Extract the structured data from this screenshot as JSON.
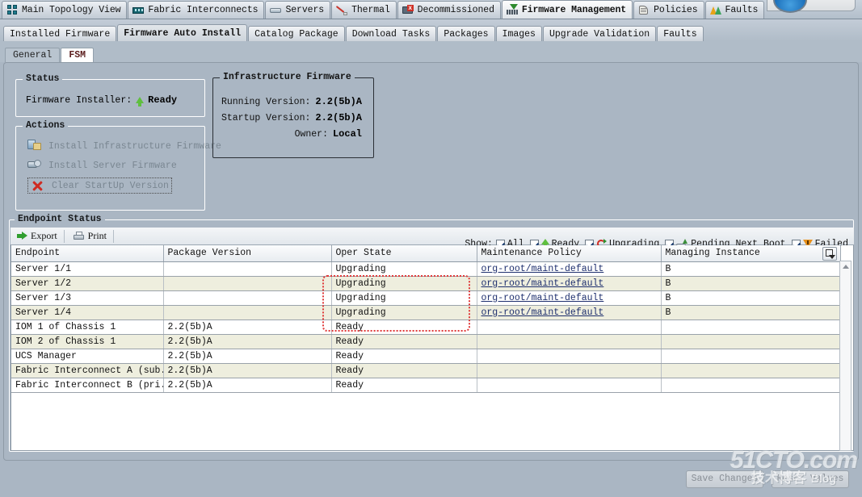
{
  "nav": {
    "tabs": [
      {
        "label": "Main Topology View",
        "icon": "topology-icon",
        "active": false
      },
      {
        "label": "Fabric Interconnects",
        "icon": "fabric-icon",
        "active": false
      },
      {
        "label": "Servers",
        "icon": "servers-icon",
        "active": false
      },
      {
        "label": "Thermal",
        "icon": "thermal-icon",
        "active": false
      },
      {
        "label": "Decommissioned",
        "icon": "decommissioned-icon",
        "active": false
      },
      {
        "label": "Firmware Management",
        "icon": "firmware-icon",
        "active": true
      },
      {
        "label": "Policies",
        "icon": "policies-icon",
        "active": false
      },
      {
        "label": "Faults",
        "icon": "faults-icon",
        "active": false
      }
    ]
  },
  "subnav": {
    "tabs": [
      {
        "label": "Installed Firmware",
        "active": false
      },
      {
        "label": "Firmware Auto Install",
        "active": true
      },
      {
        "label": "Catalog Package",
        "active": false
      },
      {
        "label": "Download Tasks",
        "active": false
      },
      {
        "label": "Packages",
        "active": false
      },
      {
        "label": "Images",
        "active": false
      },
      {
        "label": "Upgrade Validation",
        "active": false
      },
      {
        "label": "Faults",
        "active": false
      }
    ]
  },
  "tertnav": {
    "tabs": [
      {
        "label": "General",
        "active": false
      },
      {
        "label": "FSM",
        "active": true
      }
    ]
  },
  "status": {
    "legend": "Status",
    "installer_label": "Firmware Installer:",
    "installer_value": "Ready",
    "installer_icon": "green-up-arrow-icon"
  },
  "actions": {
    "legend": "Actions",
    "items": [
      {
        "label": "Install Infrastructure Firmware",
        "icon": "install-infrastructure-icon"
      },
      {
        "label": "Install Server Firmware",
        "icon": "install-server-icon"
      },
      {
        "label": "Clear StartUp Version",
        "icon": "clear-red-x-icon"
      }
    ]
  },
  "infrastructure": {
    "legend": "Infrastructure Firmware",
    "rows": [
      {
        "label": "Running Version:",
        "value": "2.2(5b)A"
      },
      {
        "label": "Startup Version:",
        "value": "2.2(5b)A"
      },
      {
        "label": "Owner:",
        "value": "Local"
      }
    ]
  },
  "endpoint": {
    "legend": "Endpoint Status",
    "toolbar": {
      "export_label": "Export",
      "print_label": "Print"
    },
    "filters": {
      "show_label": "Show:",
      "items": [
        {
          "label": "All",
          "checked": true,
          "icon": null
        },
        {
          "label": "Ready",
          "checked": true,
          "icon": "green-up-arrow-icon"
        },
        {
          "label": "Upgrading",
          "checked": true,
          "icon": "refresh-circular-arrows-icon"
        },
        {
          "label": "Pending Next Boot",
          "checked": true,
          "icon": "server-pending-boot-icon"
        },
        {
          "label": "Failed",
          "checked": true,
          "icon": "orange-warning-triangle-icon"
        }
      ]
    },
    "columns": [
      "Endpoint",
      "Package Version",
      "Oper State",
      "Maintenance Policy",
      "Managing Instance"
    ],
    "rows": [
      {
        "endpoint": "Server 1/1",
        "package_version": "",
        "oper_state": "Upgrading",
        "maintenance_policy": "org-root/maint-default",
        "managing_instance": "B"
      },
      {
        "endpoint": "Server 1/2",
        "package_version": "",
        "oper_state": "Upgrading",
        "maintenance_policy": "org-root/maint-default",
        "managing_instance": "B"
      },
      {
        "endpoint": "Server 1/3",
        "package_version": "",
        "oper_state": "Upgrading",
        "maintenance_policy": "org-root/maint-default",
        "managing_instance": "B"
      },
      {
        "endpoint": "Server 1/4",
        "package_version": "",
        "oper_state": "Upgrading",
        "maintenance_policy": "org-root/maint-default",
        "managing_instance": "B"
      },
      {
        "endpoint": "IOM 1 of Chassis 1",
        "package_version": "2.2(5b)A",
        "oper_state": "Ready",
        "maintenance_policy": "",
        "managing_instance": ""
      },
      {
        "endpoint": "IOM 2 of Chassis 1",
        "package_version": "2.2(5b)A",
        "oper_state": "Ready",
        "maintenance_policy": "",
        "managing_instance": ""
      },
      {
        "endpoint": "UCS Manager",
        "package_version": "2.2(5b)A",
        "oper_state": "Ready",
        "maintenance_policy": "",
        "managing_instance": ""
      },
      {
        "endpoint": "Fabric Interconnect A (sub...",
        "package_version": "2.2(5b)A",
        "oper_state": "Ready",
        "maintenance_policy": "",
        "managing_instance": ""
      },
      {
        "endpoint": "Fabric Interconnect B (pri...",
        "package_version": "2.2(5b)A",
        "oper_state": "Ready",
        "maintenance_policy": "",
        "managing_instance": ""
      }
    ]
  },
  "buttons": {
    "save_label": "Save Changes",
    "reset_label": "Reset Values"
  },
  "watermark": {
    "line1": "51CTO.com",
    "line2_cn": "技术博客",
    "line2_en": "Blog"
  },
  "colors": {
    "accent_blue": "#1b6fba",
    "link": "#1e2f6e",
    "annotation_red": "#e03a3a",
    "ready_green": "#5fbf3f",
    "failed_orange": "#e8901a",
    "panel_bg": "#aab6c3",
    "row_alt": "#eeeede"
  }
}
